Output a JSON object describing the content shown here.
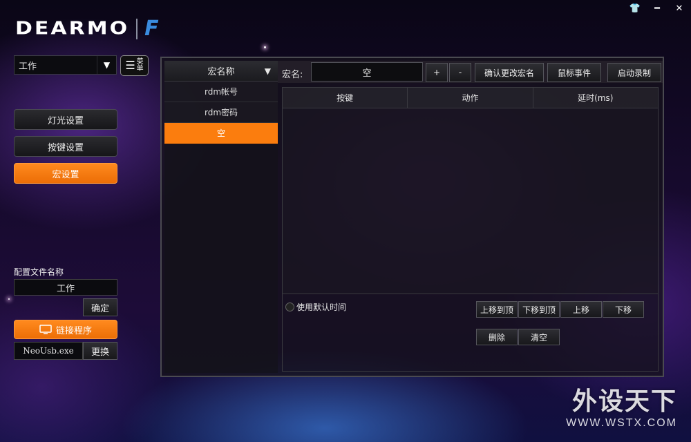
{
  "window": {
    "controls": [
      "shirt-icon",
      "minimize-icon",
      "close-icon"
    ]
  },
  "logo": {
    "text": "DEARMO",
    "mark": "F"
  },
  "profile": {
    "selected": "工作",
    "menu_label_1": "菜",
    "menu_label_2": "单"
  },
  "sidebar": {
    "items": [
      {
        "label": "灯光设置",
        "active": false
      },
      {
        "label": "按键设置",
        "active": false
      },
      {
        "label": "宏设置",
        "active": true
      }
    ]
  },
  "config": {
    "label": "配置文件名称",
    "name": "工作",
    "confirm_label": "确定",
    "link_label": "链接程序",
    "exe": "NeoUsb.exe",
    "change_label": "更换"
  },
  "macro_list": {
    "header": "宏名称",
    "items": [
      {
        "label": "rdm帐号",
        "selected": false
      },
      {
        "label": "rdm密码",
        "selected": false
      },
      {
        "label": "空",
        "selected": true
      }
    ]
  },
  "editor": {
    "name_label": "宏名:",
    "name_value": "空",
    "plus_label": "+",
    "minus_label": "-",
    "confirm_rename_label": "确认更改宏名",
    "mouse_event_label": "鼠标事件",
    "start_record_label": "启动录制",
    "columns": [
      "按键",
      "动作",
      "延时(ms)"
    ],
    "default_time_label": "使用默认时间",
    "move_top_label": "上移到顶",
    "move_bottom_label": "下移到顶",
    "move_up_label": "上移",
    "move_down_label": "下移",
    "delete_label": "删除",
    "clear_label": "清空"
  },
  "watermark": {
    "cn": "外设天下",
    "en": "WWW.WSTX.COM"
  },
  "colors": {
    "accent": "#fb7d0e",
    "logo_mark": "#3a8ce0"
  }
}
